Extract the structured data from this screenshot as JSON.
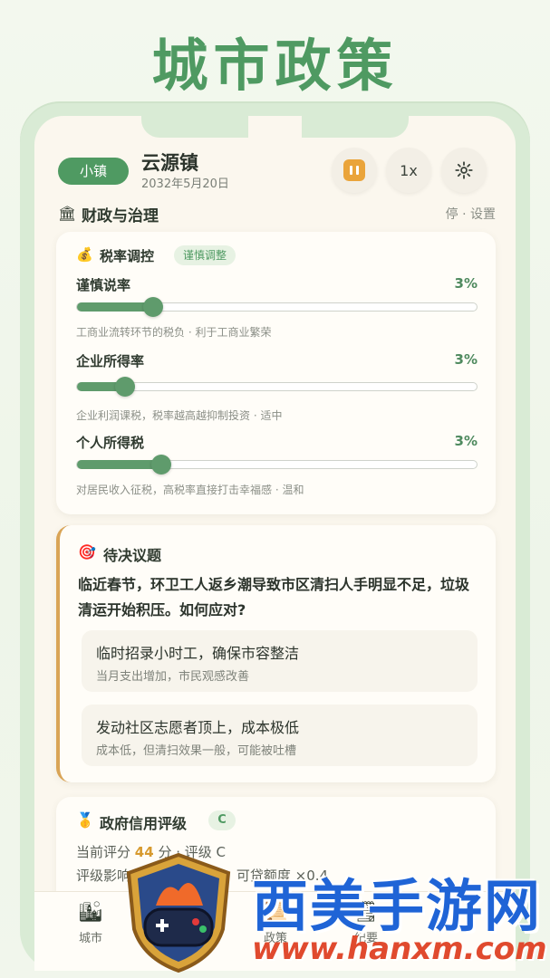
{
  "hero_title": "城市政策",
  "header": {
    "badge": "小镇",
    "town_name": "云源镇",
    "date": "2032年5月20日",
    "speed": "1x",
    "pause_icon": "pause-icon",
    "settings_icon": "gear-icon"
  },
  "section": {
    "title": "财政与治理",
    "right": "停 · 设置",
    "icon": "government-building-icon"
  },
  "tax": {
    "title": "税率调控",
    "mode": "谨慎调整",
    "rows": [
      {
        "name": "谨慎说率",
        "value": "3%",
        "level": 0.19,
        "desc": "工商业流转环节的税负 · 利于工商业繁荣"
      },
      {
        "name": "企业所得率",
        "value": "3%",
        "level": 0.12,
        "desc": "企业利润课税，税率越高越抑制投资 · 适中"
      },
      {
        "name": "个人所得税",
        "value": "3%",
        "level": 0.21,
        "desc": "对居民收入征税，高税率直接打击幸福感 · 温和"
      }
    ]
  },
  "issue": {
    "title": "待决议题",
    "question": "临近春节，环卫工人返乡潮导致市区清扫人手明显不足，垃圾清运开始积压。如何应对?",
    "options": [
      {
        "title": "临时招录小时工，确保市容整洁",
        "desc": "当月支出增加，市民观感改善"
      },
      {
        "title": "发动社区志愿者顶上，成本极低",
        "desc": "成本低，但清扫效果一般，可能被吐槽"
      }
    ]
  },
  "credit": {
    "title": "政府信用评级",
    "grade": "C",
    "score_prefix": "当前评分",
    "score": "44",
    "score_suffix": "分 · 评级 C",
    "impact": "评级影响：贷款利率 ×2、可贷额度 ×0.4"
  },
  "tabs": [
    {
      "label": "城市",
      "icon": "city-icon"
    },
    {
      "label": "政策",
      "icon": "policy-icon"
    },
    {
      "label": "纪要",
      "icon": "notes-icon"
    }
  ],
  "watermark": {
    "brand": "西美手游网",
    "url": "www.hanxm.com",
    "colors": {
      "blue": "#1f64d6",
      "red": "#e33a3a"
    }
  }
}
